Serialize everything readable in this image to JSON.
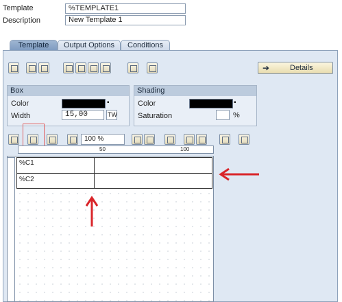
{
  "header": {
    "template_label": "Template",
    "template_value": "%TEMPLATE1",
    "description_label": "Description",
    "description_value": "New Template 1"
  },
  "tabs": [
    {
      "label": "Template",
      "active": true
    },
    {
      "label": "Output Options",
      "active": false
    },
    {
      "label": "Conditions",
      "active": false
    }
  ],
  "details_button": "Details",
  "box": {
    "title": "Box",
    "color_label": "Color",
    "width_label": "Width",
    "width_value": "15,00",
    "width_unit": "TW",
    "color_value": "#000000"
  },
  "shading": {
    "title": "Shading",
    "color_label": "Color",
    "saturation_label": "Saturation",
    "saturation_unit": "%",
    "color_value": "#000000"
  },
  "toolbar2": {
    "zoom_value": "100 %"
  },
  "ruler": {
    "ticks": [
      "50",
      "100"
    ]
  },
  "cells": [
    {
      "label": "%C1"
    },
    {
      "label": "%C2"
    }
  ],
  "colors": {
    "tab_active": "#8ea9cb",
    "panel_bg": "#dfe8f3",
    "annotation_red": "#d9252a",
    "highlight_box": "#e06060"
  }
}
